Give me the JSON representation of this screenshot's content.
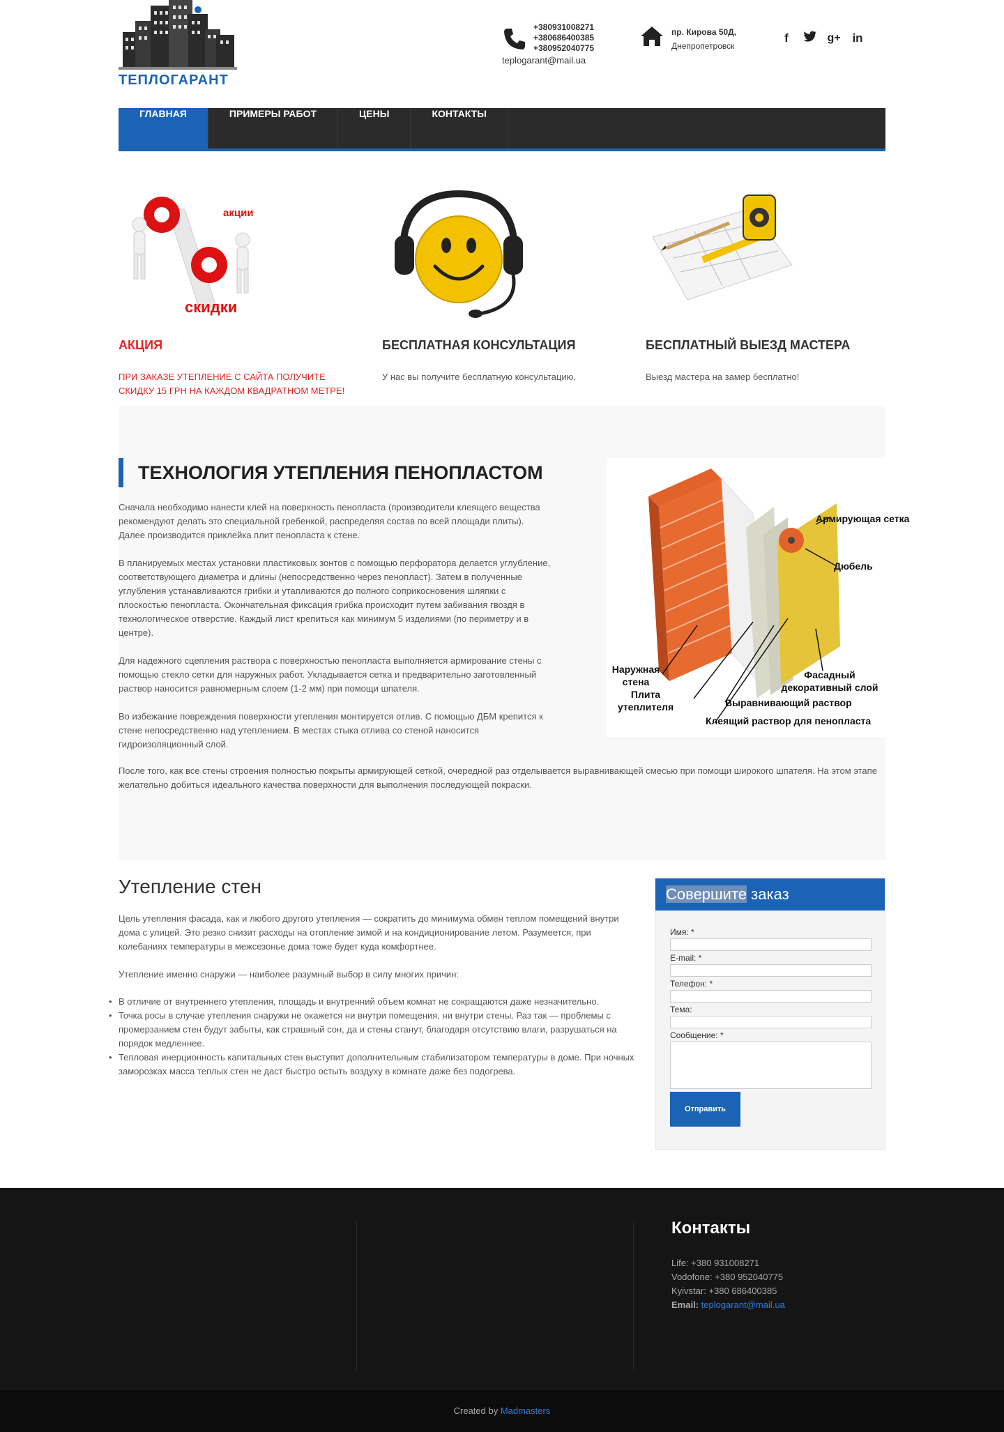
{
  "header": {
    "logo_text": "ТЕПЛОГАРАНТ",
    "phones": [
      "+380931008271",
      "+380686400385",
      "+380952040775"
    ],
    "email": "teplogarant@mail.ua",
    "address_line1": "пр. Кирова 50Д,",
    "address_line2": "Днепропетровск",
    "social": [
      "facebook-icon",
      "twitter-icon",
      "google-plus-icon",
      "linkedin-icon"
    ]
  },
  "nav": {
    "items": [
      {
        "label": "ГЛАВНАЯ",
        "active": true
      },
      {
        "label": "ПРИМЕРЫ РАБОТ",
        "active": false
      },
      {
        "label": "ЦЕНЫ",
        "active": false
      },
      {
        "label": "КОНТАКТЫ",
        "active": false
      }
    ]
  },
  "features": [
    {
      "title": "АКЦИЯ",
      "text": "ПРИ ЗАКАЗЕ УТЕПЛЕНИЕ С САЙТА ПОЛУЧИТЕ СКИДКУ 15 ГРН НА КАЖДОМ КВАДРАТНОМ МЕТРЕ!",
      "img_text1": "акции",
      "img_text2": "скидки"
    },
    {
      "title": "БЕСПЛАТНАЯ КОНСУЛЬТАЦИЯ",
      "text": "У нас вы получите бесплатную консультацию."
    },
    {
      "title": "БЕСПЛАТНЫЙ ВЫЕЗД МАСТЕРА",
      "text": "Выезд мастера на замер бесплатно!"
    }
  ],
  "tech": {
    "title": "ТЕХНОЛОГИЯ УТЕПЛЕНИЯ ПЕНОПЛАСТОМ",
    "paragraphs": [
      "Сначала необходимо нанести клей на поверхность пенопласта (производители клеящего вещества рекомендуют делать это специальной гребенкой, распределяя состав по всей площади плиты). Далее производится приклейка плит пенопласта к стене.",
      "В планируемых местах установки пластиковых зонтов с помощью перфоратора делается углубление, соответствующего диаметра и длины (непосредственно через пенопласт). Затем в полученные углубления устанавливаются грибки и утапливаются до полного соприкосновения шляпки с плоскостью пенопласта. Окончательная фиксация грибка происходит путем забивания гвоздя в технологическое отверстие. Каждый лист крепиться как минимум 5 изделиями (по периметру и в центре).",
      "Для надежного сцепления раствора с поверхностью пенопласта выполняется армирование стены с помощью стекло сетки для наружных работ. Укладывается сетка и предварительно заготовленный раствор наносится равномерным слоем (1-2 мм) при помощи шпателя.",
      "Во избежание повреждения поверхности утепления монтируется отлив. С помощью ДБМ крепится к стене непосредственно над утеплением. В местах стыка отлива со стеной наносится гидроизоляционный слой."
    ],
    "wide_paragraph": "После того, как все стены строения полностью покрыты армирующей сеткой, очередной раз отделывается выравнивающей смесью при помощи широкого шпателя. На этом этапе желательно добиться идеального качества поверхности для выполнения последующей покраски.",
    "diagram_labels": {
      "mesh": "Армирующая сетка",
      "dowel": "Дюбель",
      "outer_wall": "Наружная стена",
      "insulation": "Плита утеплителя",
      "facade": "Фасадный декоративный слой",
      "leveling": "Выравнивающий раствор",
      "adhesive": "Клеящий раствор для пенопласта"
    }
  },
  "walls": {
    "title": "Утепление стен",
    "paragraphs": [
      "Цель утепления фасада, как и любого другого утепления — сократить до минимума обмен теплом помещений внутри дома с улицей. Это резко снизит расходы на отопление зимой и на кондиционирование летом. Разумеется, при колебаниях температуры в межсезонье дома тоже будет куда комфортнее.",
      "Утепление именно снаружи — наиболее разумный выбор в силу многих причин:"
    ],
    "list": [
      "В отличие от внутреннего утепления, площадь и внутренний объем комнат не сокращаются даже незначительно.",
      "Точка росы в случае утепления снаружи не окажется ни внутри помещения, ни внутри стены. Раз так — проблемы с промерзанием стен будут забыты, как страшный сон, да и стены станут, благодаря отсутствию влаги, разрушаться на порядок медленнее.",
      "Тепловая инерционность капитальных стен выступит дополнительным стабилизатором температуры в доме. При ночных заморозках масса теплых стен не даст быстро остыть воздуху в комнате даже без подогрева."
    ]
  },
  "order": {
    "title_highlight": "Совершите",
    "title_rest": " заказ",
    "fields": [
      "Имя: *",
      "E-mail: *",
      "Телефон: *",
      "Тема:",
      "Сообщение: *"
    ],
    "submit": "Отправить"
  },
  "footer": {
    "title": "Контакты",
    "life": "Life: +380 931008271",
    "vodafone": "Vodofone: +380 952040775",
    "kyivstar": "Kyivstar: +380 686400385",
    "email_label": "Email:",
    "email": "teplogarant@mail.ua",
    "created_by": "Created by ",
    "creator": "Madmasters"
  }
}
